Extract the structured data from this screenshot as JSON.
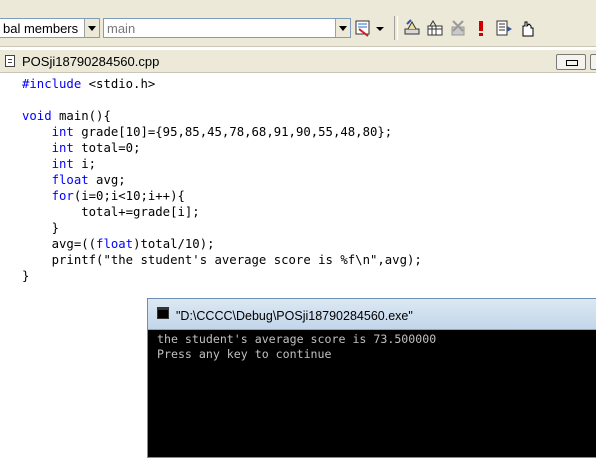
{
  "toolbar": {
    "members_combo": "bal members",
    "function_combo": "main"
  },
  "editor": {
    "filename": "POSji18790284560.cpp"
  },
  "code": {
    "l1_kw": "#include",
    "l1_rest": " <stdio.h>",
    "l3_kw": "void",
    "l3_rest": " main(){",
    "l4_kw": "int",
    "l4_rest": " grade[10]={95,85,45,78,68,91,90,55,48,80};",
    "l5_kw": "int",
    "l5_rest": " total=0;",
    "l6_kw": "int",
    "l6_rest": " i;",
    "l7_kw": "float",
    "l7_rest": " avg;",
    "l8_kw": "for",
    "l8_rest": "(i=0;i<10;i++){",
    "l9": "total+=grade[i];",
    "l10": "}",
    "l11_pre": "avg=((",
    "l11_kw": "float",
    "l11_post": ")total/10);",
    "l12": "printf(\"the student's average score is %f\\n\",avg);",
    "l13": "}"
  },
  "console": {
    "title": "\"D:\\CCCC\\Debug\\POSji18790284560.exe\"",
    "line1": "the student's average score is 73.500000",
    "line2": "Press any key to continue"
  },
  "icons": [
    "dropdown-arrow-icon",
    "class-wizard-icon",
    "compile-icon",
    "build-icon",
    "stop-build-icon",
    "execute-icon",
    "go-icon",
    "insert-breakpoint-icon"
  ]
}
